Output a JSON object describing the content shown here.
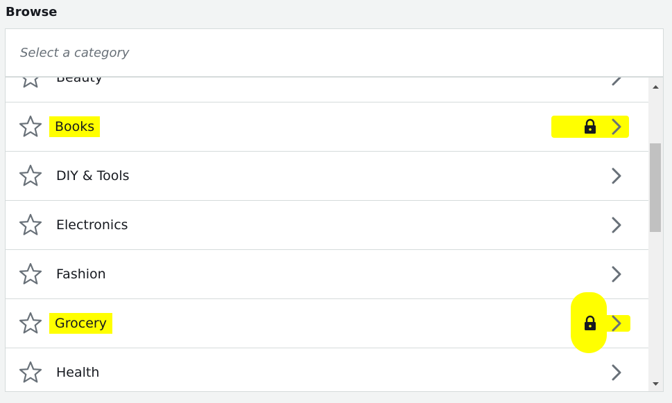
{
  "header": {
    "title": "Browse"
  },
  "search": {
    "placeholder": "Select a category",
    "value": ""
  },
  "categories": [
    {
      "label": "Beauty",
      "locked": false,
      "highlighted": false
    },
    {
      "label": "Books",
      "locked": true,
      "highlighted": true
    },
    {
      "label": "DIY & Tools",
      "locked": false,
      "highlighted": false
    },
    {
      "label": "Electronics",
      "locked": false,
      "highlighted": false
    },
    {
      "label": "Fashion",
      "locked": false,
      "highlighted": false
    },
    {
      "label": "Grocery",
      "locked": true,
      "highlighted": true
    },
    {
      "label": "Health",
      "locked": false,
      "highlighted": false
    }
  ],
  "icons": {
    "favorite": "star-outline-icon",
    "locked": "lock-icon",
    "open": "chevron-right-icon"
  },
  "colors": {
    "highlight": "#ffff00",
    "text": "#16191f",
    "icon": "#687078",
    "divider": "#d5dbdb"
  }
}
